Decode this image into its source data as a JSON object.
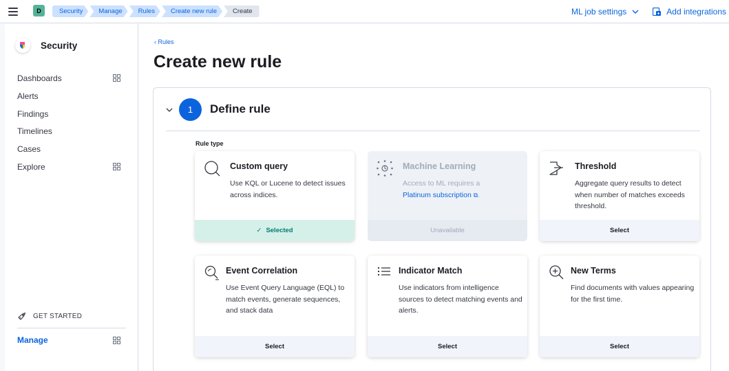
{
  "topbar": {
    "space_initial": "D",
    "breadcrumbs": [
      "Security",
      "Manage",
      "Rules",
      "Create new rule",
      "Create"
    ],
    "ml_settings_label": "ML job settings",
    "add_integrations_label": "Add integrations"
  },
  "sidebar": {
    "title": "Security",
    "items": [
      {
        "label": "Dashboards",
        "has_grid_icon": true
      },
      {
        "label": "Alerts",
        "has_grid_icon": false
      },
      {
        "label": "Findings",
        "has_grid_icon": false
      },
      {
        "label": "Timelines",
        "has_grid_icon": false
      },
      {
        "label": "Cases",
        "has_grid_icon": false
      },
      {
        "label": "Explore",
        "has_grid_icon": true
      }
    ],
    "get_started_label": "GET STARTED",
    "manage_label": "Manage"
  },
  "main": {
    "back_label": "Rules",
    "title": "Create new rule",
    "step": {
      "number": "1",
      "title": "Define rule",
      "rule_type_label": "Rule type"
    },
    "cards": [
      {
        "title": "Custom query",
        "icon": "search-icon",
        "desc": "Use KQL or Lucene to detect issues across indices.",
        "footer": "Selected",
        "state": "selected"
      },
      {
        "title": "Machine Learning",
        "icon": "machine-learning-icon",
        "desc_pre": "Access to ML requires a",
        "desc_link": "Platinum subscription",
        "desc_post": ".",
        "footer": "Unavailable",
        "state": "disabled"
      },
      {
        "title": "Threshold",
        "icon": "threshold-icon",
        "desc": "Aggregate query results to detect when number of matches exceeds threshold.",
        "footer": "Select",
        "state": "default"
      },
      {
        "title": "Event Correlation",
        "icon": "magnifier-dots-icon",
        "desc": "Use Event Query Language (EQL) to match events, generate sequences, and stack data",
        "footer": "Select",
        "state": "default"
      },
      {
        "title": "Indicator Match",
        "icon": "list-icon",
        "desc": "Use indicators from intelligence sources to detect matching events and alerts.",
        "footer": "Select",
        "state": "default"
      },
      {
        "title": "New Terms",
        "icon": "zoom-in-icon",
        "desc": "Find documents with values appearing for the first time.",
        "footer": "Select",
        "state": "default"
      }
    ]
  },
  "colors": {
    "primary": "#0b64dd",
    "selected_bg": "#d5f0e8",
    "selected_text": "#017d73",
    "space_badge": "#54b399"
  }
}
